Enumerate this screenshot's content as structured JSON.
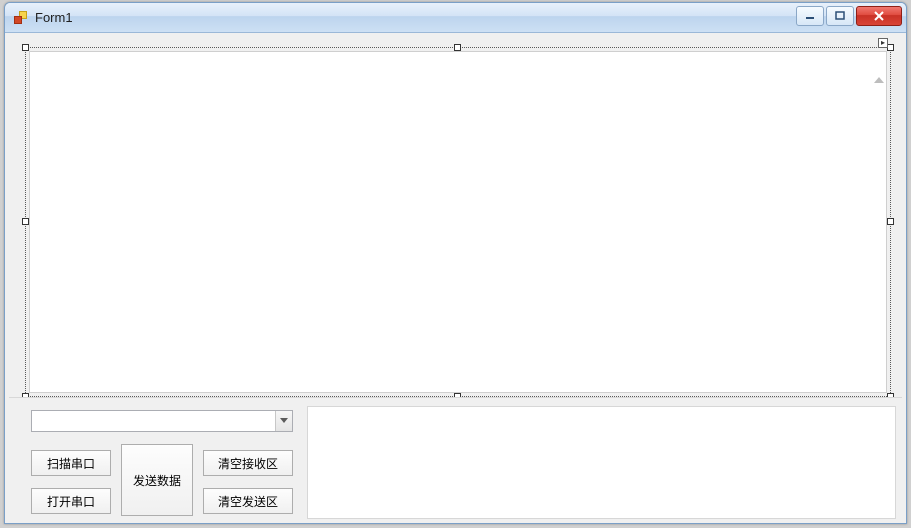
{
  "window": {
    "title": "Form1"
  },
  "controls": {
    "combo_value": "",
    "scan_label": "扫描串口",
    "open_label": "打开串口",
    "send_label": "发送数据",
    "clear_rx_label": "清空接收区",
    "clear_tx_label": "清空发送区",
    "receive_text": "",
    "send_text": ""
  }
}
